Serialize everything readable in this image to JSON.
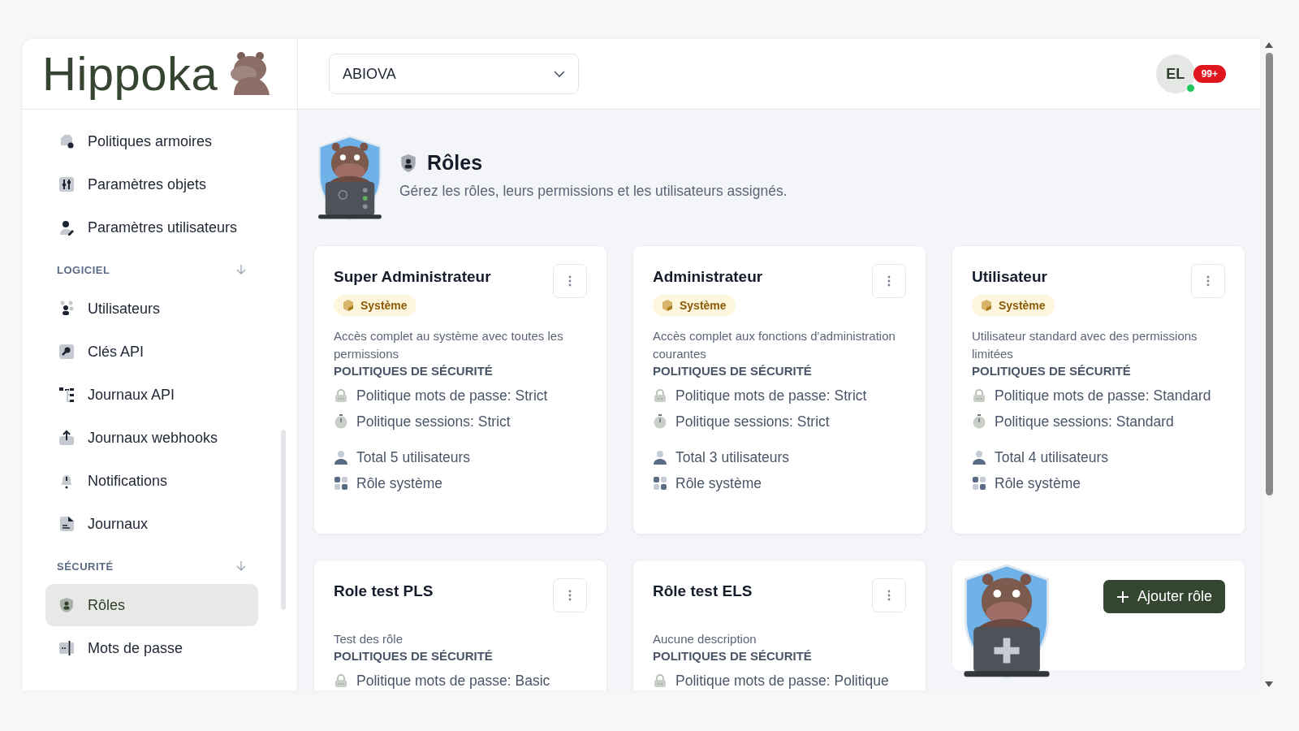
{
  "sidebar": {
    "logo": "Hippoka",
    "sections": [
      {
        "items": [
          {
            "label": "Politiques armoires",
            "selected": false
          },
          {
            "label": "Paramètres objets",
            "selected": false
          },
          {
            "label": "Paramètres utilisateurs",
            "selected": false
          }
        ]
      },
      {
        "title": "LOGICIEL",
        "items": [
          {
            "label": "Utilisateurs",
            "selected": false
          },
          {
            "label": "Clés API",
            "selected": false
          },
          {
            "label": "Journaux API",
            "selected": false
          },
          {
            "label": "Journaux webhooks",
            "selected": false
          },
          {
            "label": "Notifications",
            "selected": false
          },
          {
            "label": "Journaux",
            "selected": false
          }
        ]
      },
      {
        "title": "SÉCURITÉ",
        "items": [
          {
            "label": "Rôles",
            "selected": true
          },
          {
            "label": "Mots de passe",
            "selected": false
          }
        ]
      }
    ]
  },
  "topbar": {
    "organization": "ABIOVA",
    "user": {
      "initials": "EL",
      "online": true
    },
    "notifications": "99+"
  },
  "header": {
    "title": "Rôles",
    "description": "Gérez les rôles, leurs permissions et les utilisateurs assignés."
  },
  "roles": [
    {
      "kind": "role",
      "name": "Super Administrateur",
      "badge": "Système",
      "description": "Accès complet au système avec toutes les permissions",
      "policies_heading": "POLITIQUES DE SÉCURITÉ",
      "policies": [
        "Politique mots de passe: Strict",
        "Politique sessions: Strict"
      ],
      "stats": [
        "Total 5 utilisateurs",
        "Rôle système"
      ]
    },
    {
      "kind": "role",
      "name": "Administrateur",
      "badge": "Système",
      "description": "Accès complet aux fonctions d'administration courantes",
      "policies_heading": "POLITIQUES DE SÉCURITÉ",
      "policies": [
        "Politique mots de passe: Strict",
        "Politique sessions: Strict"
      ],
      "stats": [
        "Total 3 utilisateurs",
        "Rôle système"
      ]
    },
    {
      "kind": "role",
      "name": "Utilisateur",
      "badge": "Système",
      "description": "Utilisateur standard avec des permissions limitées",
      "policies_heading": "POLITIQUES DE SÉCURITÉ",
      "policies": [
        "Politique mots de passe: Standard",
        "Politique sessions: Standard"
      ],
      "stats": [
        "Total 4 utilisateurs",
        "Rôle système"
      ]
    },
    {
      "kind": "role",
      "name": "Role test PLS",
      "description": "Test des rôle",
      "policies_heading": "POLITIQUES DE SÉCURITÉ",
      "policies": [
        "Politique mots de passe: Basic"
      ]
    },
    {
      "kind": "role",
      "name": "Rôle test ELS",
      "description": "Aucune description",
      "policies_heading": "POLITIQUES DE SÉCURITÉ",
      "policies": [
        "Politique mots de passe: Politique"
      ]
    },
    {
      "kind": "add",
      "button": "Ajouter rôle"
    }
  ]
}
